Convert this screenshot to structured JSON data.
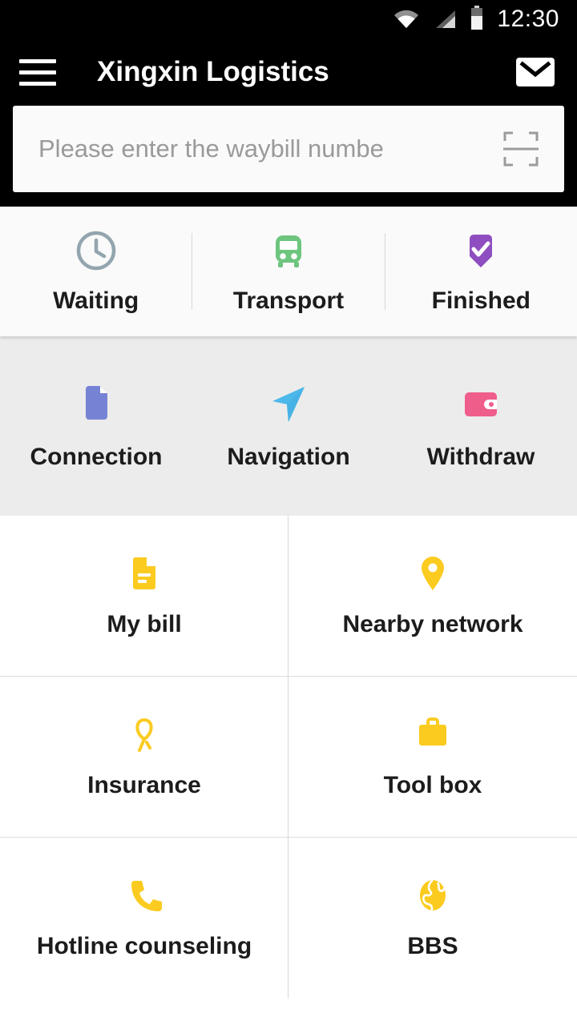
{
  "statusbar": {
    "time": "12:30",
    "icons": [
      "wifi-icon",
      "cellular-signal-icon",
      "battery-icon"
    ]
  },
  "appbar": {
    "menu_icon": "hamburger-menu-icon",
    "title": "Xingxin Logistics",
    "mail_icon": "envelope-icon"
  },
  "search": {
    "placeholder": "Please enter the waybill numbe",
    "scan_icon": "scan-qr-icon"
  },
  "status_tabs": [
    {
      "label": "Waiting",
      "icon": "clock-icon",
      "color": "#93a5ae"
    },
    {
      "label": "Transport",
      "icon": "bus-icon",
      "color": "#6ec57e"
    },
    {
      "label": "Finished",
      "icon": "shield-check-icon",
      "color": "#8e4ec0"
    }
  ],
  "shortcuts": [
    {
      "label": "Connection",
      "icon": "document-icon",
      "color": "#7683d4"
    },
    {
      "label": "Navigation",
      "icon": "navigation-arrow-icon",
      "color": "#4db8ea"
    },
    {
      "label": "Withdraw",
      "icon": "wallet-icon",
      "color": "#ef5d8b"
    }
  ],
  "menu_grid": [
    {
      "label": "My bill",
      "icon": "bill-document-icon"
    },
    {
      "label": "Nearby network",
      "icon": "map-pin-icon"
    },
    {
      "label": "Insurance",
      "icon": "ribbon-icon"
    },
    {
      "label": "Tool box",
      "icon": "briefcase-icon"
    },
    {
      "label": "Hotline counseling",
      "icon": "phone-icon"
    },
    {
      "label": "BBS",
      "icon": "globe-icon"
    }
  ],
  "colors": {
    "header_bg": "#000000",
    "accent_yellow": "#fbcb20",
    "card_bg": "#fafafa",
    "shortcut_bg": "#ececec"
  }
}
